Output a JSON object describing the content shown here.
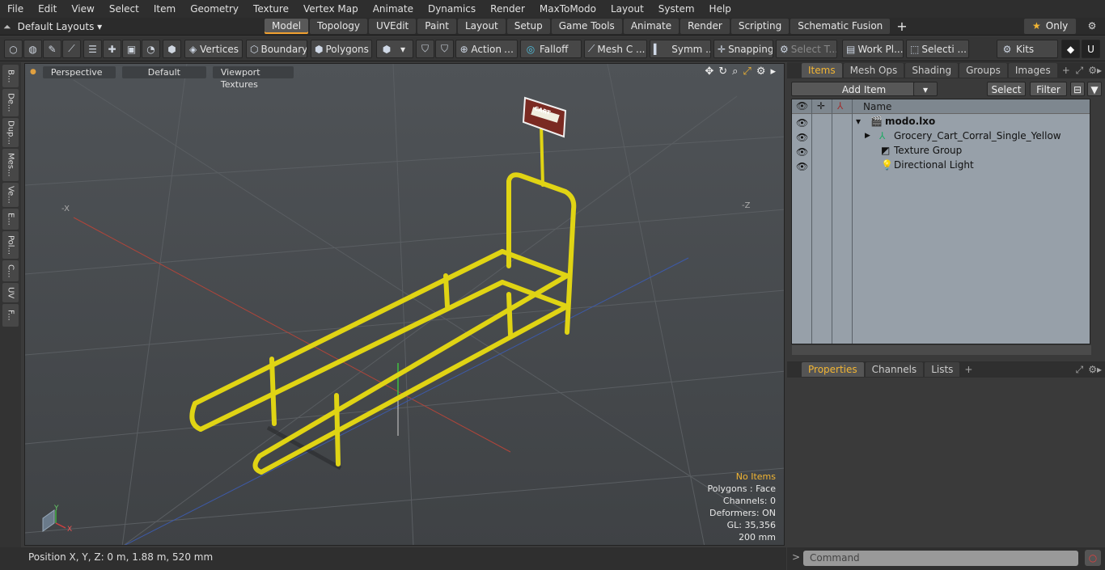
{
  "menu": [
    "File",
    "Edit",
    "View",
    "Select",
    "Item",
    "Geometry",
    "Texture",
    "Vertex Map",
    "Animate",
    "Dynamics",
    "Render",
    "MaxToModo",
    "Layout",
    "System",
    "Help"
  ],
  "layout": {
    "label": "Default Layouts",
    "tabs": [
      "Model",
      "Topology",
      "UVEdit",
      "Paint",
      "Layout",
      "Setup",
      "Game Tools",
      "Animate",
      "Render",
      "Scripting",
      "Schematic Fusion"
    ],
    "active": "Model",
    "only_label": "Only"
  },
  "toolbar": {
    "vertices": "Vertices",
    "boundary": "Boundary",
    "polygons": "Polygons",
    "action": "Action",
    "falloff": "Falloff",
    "mesh": "Mesh C ...",
    "symm": "Symm ...",
    "snapping": "Snapping",
    "select_t": "Select T...",
    "workpl": "Work Pl...",
    "selecti": "Selecti ...",
    "kits": "Kits"
  },
  "left_tabs": [
    "B...",
    "De...",
    "Dup...",
    "Mes...",
    "Ve...",
    "E...",
    "Pol...",
    "C...",
    "UV",
    "F..."
  ],
  "viewport": {
    "view": "Perspective",
    "shading": "Default",
    "textures": "Viewport Textures",
    "sign_title": "CART",
    "info": {
      "items": "No Items",
      "polygons": "Polygons : Face",
      "channels": "Channels: 0",
      "deformers": "Deformers: ON",
      "gl": "GL: 35,356",
      "size": "200 mm"
    },
    "axis_labels": {
      "x": "X",
      "y": "Y",
      "neg_x": "-X",
      "neg_z": "-Z"
    }
  },
  "status": {
    "position": "Position X, Y, Z:   0 m, 1.88 m, 520 mm"
  },
  "items_panel": {
    "tabs": [
      "Items",
      "Mesh Ops",
      "Shading",
      "Groups",
      "Images"
    ],
    "active": "Items",
    "add_item": "Add Item",
    "select": "Select",
    "filter": "Filter",
    "name_header": "Name",
    "rows": [
      {
        "label": "modo.lxo",
        "bold": true
      },
      {
        "label": "Grocery_Cart_Corral_Single_Yellow"
      },
      {
        "label": "Texture Group"
      },
      {
        "label": "Directional Light"
      }
    ]
  },
  "props_panel": {
    "tabs": [
      "Properties",
      "Channels",
      "Lists"
    ],
    "active": "Properties"
  },
  "command": {
    "placeholder": "Command"
  }
}
